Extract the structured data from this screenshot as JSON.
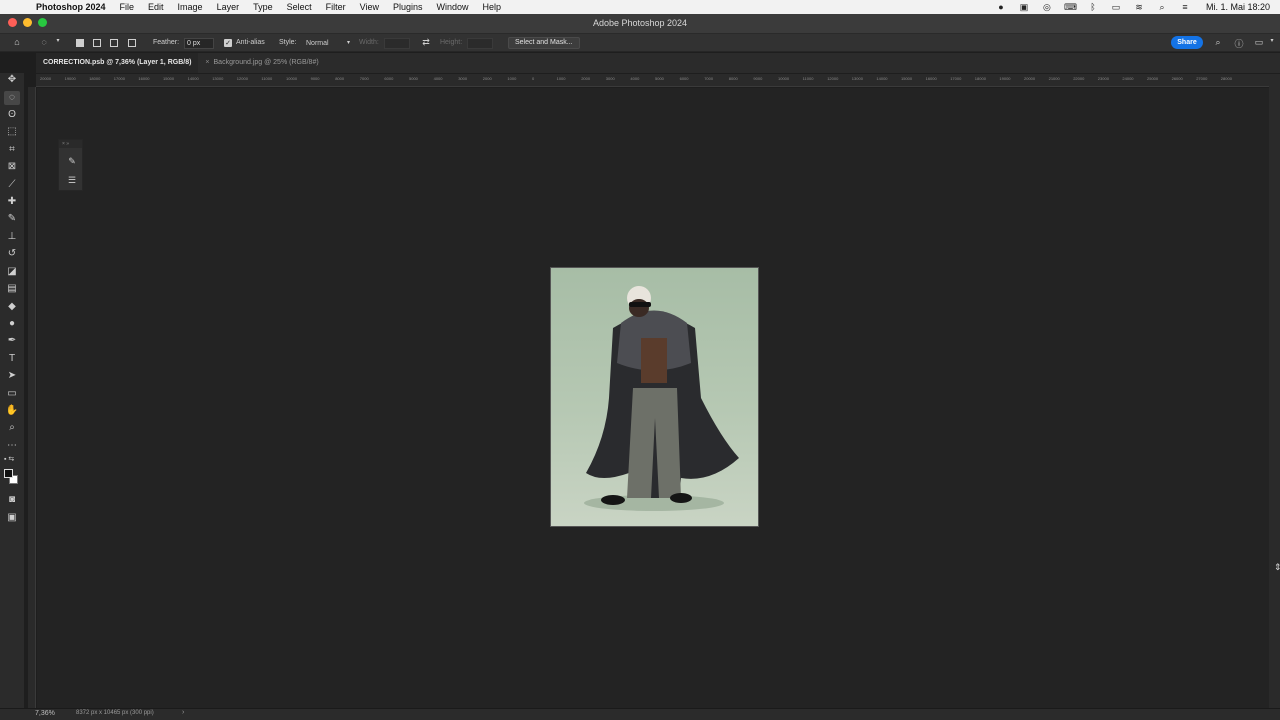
{
  "menubar": {
    "app_name": "Photoshop 2024",
    "items": [
      "File",
      "Edit",
      "Image",
      "Layer",
      "Type",
      "Select",
      "Filter",
      "View",
      "Plugins",
      "Window",
      "Help"
    ],
    "clock": "Mi. 1. Mai  18:20"
  },
  "window": {
    "title": "Adobe Photoshop 2024"
  },
  "options": {
    "feather_label": "Feather:",
    "feather_value": "0 px",
    "antialias_label": "Anti-alias",
    "style_label": "Style:",
    "style_value": "Normal",
    "width_label": "Width:",
    "height_label": "Height:",
    "select_mask_label": "Select and Mask...",
    "share_label": "Share"
  },
  "tabs": [
    {
      "label": "CORRECTION.psb @ 7,36% (Layer 1, RGB/8)"
    },
    {
      "label": "Background.jpg @ 25% (RGB/8#)"
    }
  ],
  "ruler": {
    "ticks": [
      "20000",
      "19000",
      "18000",
      "17000",
      "16000",
      "15000",
      "14000",
      "13000",
      "12000",
      "11000",
      "10000",
      "9000",
      "8000",
      "7000",
      "6000",
      "5000",
      "4000",
      "3000",
      "2000",
      "1000",
      "0",
      "1000",
      "2000",
      "3000",
      "4000",
      "5000",
      "6000",
      "7000",
      "8000",
      "9000",
      "10000",
      "11000",
      "12000",
      "13000",
      "14000",
      "15000",
      "16000",
      "17000",
      "18000",
      "19000",
      "20000",
      "21000",
      "22000",
      "23000",
      "24000",
      "25000",
      "26000",
      "27000",
      "28000"
    ]
  },
  "statusbar": {
    "zoom": "7,36%",
    "doc_info": "8372 px x 10465 px (300 ppi)"
  },
  "colors": {
    "accent": "#1473e6",
    "close": "#fe5f57",
    "minimize": "#febc2e",
    "zoom": "#28c840"
  }
}
